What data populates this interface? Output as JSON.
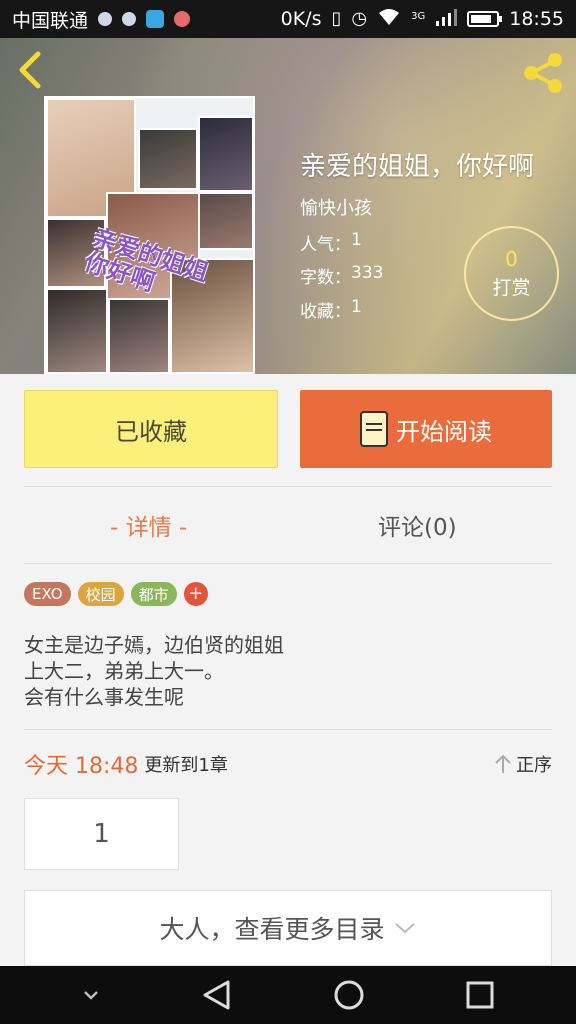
{
  "status_bar": {
    "carrier": "中国联通",
    "speed": "0K/s",
    "network": "3G",
    "time": "18:55"
  },
  "book": {
    "title": "亲爱的姐姐，你好啊",
    "author": "愉快小孩",
    "popularity_label": "人气：",
    "popularity": "1",
    "word_count_label": "字数：",
    "word_count": "333",
    "favorites_label": "收藏：",
    "favorites": "1",
    "cover_text": "亲爱的姐姐 你好啊"
  },
  "tip": {
    "count": "0",
    "label": "打赏"
  },
  "actions": {
    "favorited_label": "已收藏",
    "read_label": "开始阅读"
  },
  "tabs": {
    "details": "- 详情 -",
    "comments": "评论(0)"
  },
  "tags": [
    {
      "label": "EXO",
      "color": "#c5775d"
    },
    {
      "label": "校园",
      "color": "#d9a640"
    },
    {
      "label": "都市",
      "color": "#8cb65a"
    }
  ],
  "tag_add": "+",
  "description": [
    "女主是边子嫣，边伯贤的姐姐",
    "上大二，弟弟上大一。",
    "会有什么事发生呢"
  ],
  "update": {
    "time": "今天 18:48",
    "text": "更新到1章",
    "sort_label": "正序"
  },
  "chapters": [
    "1"
  ],
  "more_catalog": "大人，查看更多目录",
  "colors": {
    "accent_orange": "#ea6b3c",
    "fav_yellow": "#fcef7a",
    "tip_gold": "#ffe45a"
  }
}
